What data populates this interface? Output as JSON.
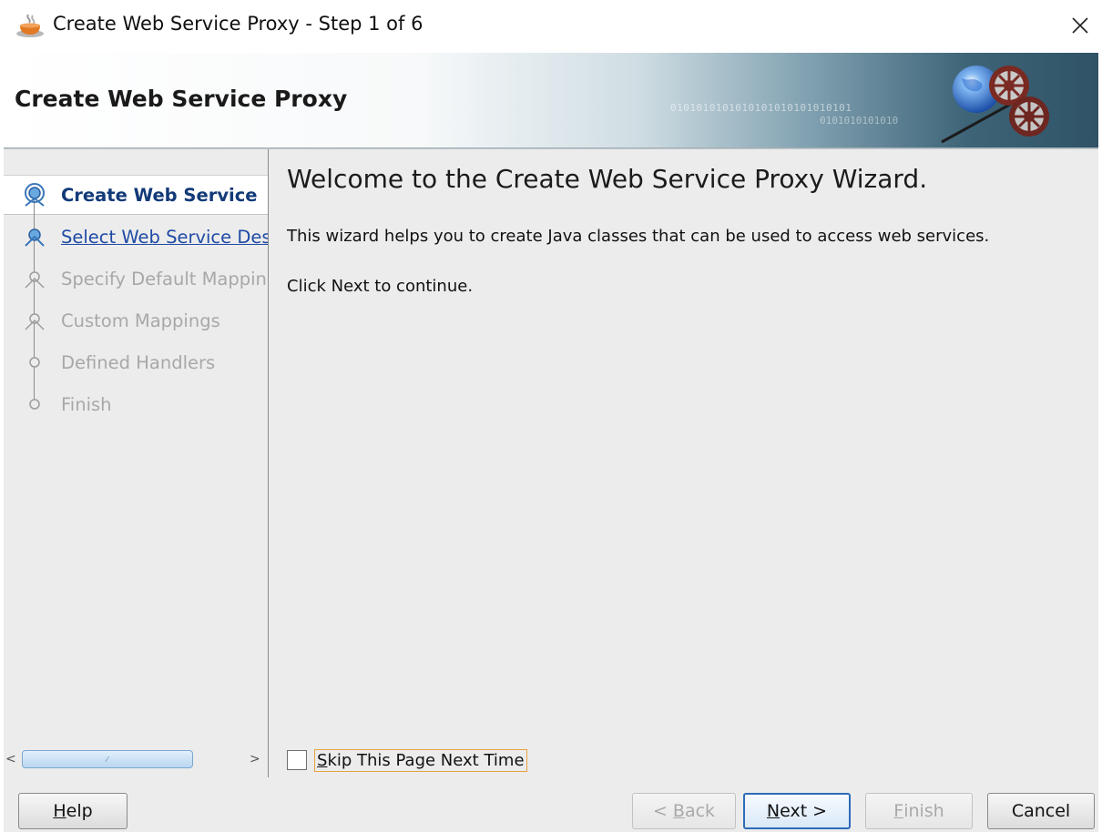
{
  "window": {
    "title": "Create Web Service Proxy - Step 1 of 6",
    "close_glyph": "✕",
    "app_icon": "coffee-cup-icon"
  },
  "banner": {
    "title": "Create Web Service Proxy",
    "binary_line1": "0101010101010101010101010101",
    "binary_line2": "0101010101010",
    "art_icon": "globe-with-gears-icon"
  },
  "steps": [
    {
      "label": "Create Web Service",
      "state": "current"
    },
    {
      "label": "Select Web Service Desc",
      "state": "link"
    },
    {
      "label": "Specify Default Mapping",
      "state": "disabled"
    },
    {
      "label": "Custom Mappings",
      "state": "disabled"
    },
    {
      "label": "Defined Handlers",
      "state": "disabled"
    },
    {
      "label": "Finish",
      "state": "disabled"
    }
  ],
  "scrollbar": {
    "left_arrow": "<",
    "right_arrow": ">",
    "grip": "⁄"
  },
  "main": {
    "heading": "Welcome to the Create Web Service Proxy Wizard.",
    "description": "This wizard helps you to create Java classes that can be used to access web services.",
    "continue_note": "Click Next to continue."
  },
  "skip_checkbox": {
    "label_mnemonic": "S",
    "label_rest": "kip This Page Next Time",
    "checked": false
  },
  "buttons": {
    "help": {
      "mnemonic": "H",
      "rest": "elp"
    },
    "back": {
      "prefix": "< ",
      "mnemonic": "B",
      "rest": "ack"
    },
    "next": {
      "mnemonic": "N",
      "rest": "ext >"
    },
    "finish": {
      "mnemonic": "F",
      "rest": "inish"
    },
    "cancel": {
      "label": "Cancel"
    }
  },
  "colors": {
    "current_step": "#123a78",
    "link_step": "#1f4aa5",
    "disabled_text": "#a8a8a8",
    "focus_outline": "#e8a33d",
    "default_button_border": "#2e6bb8"
  }
}
